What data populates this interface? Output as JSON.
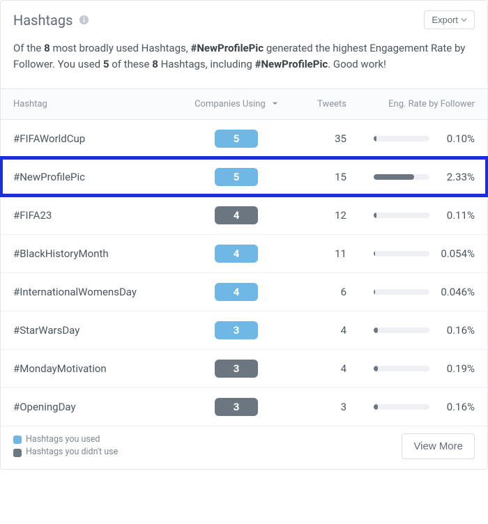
{
  "header": {
    "title": "Hashtags",
    "export_label": "Export"
  },
  "summary": {
    "pre": "Of the ",
    "total_count": "8",
    "mid1": " most broadly used Hashtags, ",
    "top_hashtag": "#NewProfilePic",
    "mid2": " generated the highest Engagement Rate by Follower. You used ",
    "used_count": "5",
    "mid3": " of these ",
    "total_count2": "8",
    "mid4": " Hashtags, including ",
    "top_hashtag2": "#NewProfilePic",
    "tail": ". Good work!"
  },
  "columns": {
    "hashtag": "Hashtag",
    "companies": "Companies Using",
    "tweets": "Tweets",
    "rate": "Eng. Rate by Follower"
  },
  "rows": [
    {
      "hashtag": "#FIFAWorldCup",
      "companies": "5",
      "used": true,
      "tweets": "35",
      "rate": "0.10%",
      "bar_pct": 5,
      "highlight": false
    },
    {
      "hashtag": "#NewProfilePic",
      "companies": "5",
      "used": true,
      "tweets": "15",
      "rate": "2.33%",
      "bar_pct": 72,
      "highlight": true
    },
    {
      "hashtag": "#FIFA23",
      "companies": "4",
      "used": false,
      "tweets": "12",
      "rate": "0.11%",
      "bar_pct": 5,
      "highlight": false
    },
    {
      "hashtag": "#BlackHistoryMonth",
      "companies": "4",
      "used": true,
      "tweets": "11",
      "rate": "0.054%",
      "bar_pct": 3,
      "highlight": false
    },
    {
      "hashtag": "#InternationalWomensDay",
      "companies": "4",
      "used": true,
      "tweets": "6",
      "rate": "0.046%",
      "bar_pct": 3,
      "highlight": false
    },
    {
      "hashtag": "#StarWarsDay",
      "companies": "3",
      "used": true,
      "tweets": "4",
      "rate": "0.16%",
      "bar_pct": 7,
      "highlight": false
    },
    {
      "hashtag": "#MondayMotivation",
      "companies": "3",
      "used": false,
      "tweets": "4",
      "rate": "0.19%",
      "bar_pct": 8,
      "highlight": false
    },
    {
      "hashtag": "#OpeningDay",
      "companies": "3",
      "used": false,
      "tweets": "3",
      "rate": "0.16%",
      "bar_pct": 7,
      "highlight": false
    }
  ],
  "legend": {
    "used": "Hashtags you used",
    "notused": "Hashtags you didn't use"
  },
  "footer": {
    "view_more": "View More"
  },
  "chart_data": {
    "type": "table",
    "title": "Hashtags",
    "columns": [
      "Hashtag",
      "Companies Using",
      "Tweets",
      "Eng. Rate by Follower"
    ],
    "series": [
      {
        "hashtag": "#FIFAWorldCup",
        "companies_using": 5,
        "you_used": true,
        "tweets": 35,
        "eng_rate_by_follower_pct": 0.1
      },
      {
        "hashtag": "#NewProfilePic",
        "companies_using": 5,
        "you_used": true,
        "tweets": 15,
        "eng_rate_by_follower_pct": 2.33
      },
      {
        "hashtag": "#FIFA23",
        "companies_using": 4,
        "you_used": false,
        "tweets": 12,
        "eng_rate_by_follower_pct": 0.11
      },
      {
        "hashtag": "#BlackHistoryMonth",
        "companies_using": 4,
        "you_used": true,
        "tweets": 11,
        "eng_rate_by_follower_pct": 0.054
      },
      {
        "hashtag": "#InternationalWomensDay",
        "companies_using": 4,
        "you_used": true,
        "tweets": 6,
        "eng_rate_by_follower_pct": 0.046
      },
      {
        "hashtag": "#StarWarsDay",
        "companies_using": 3,
        "you_used": true,
        "tweets": 4,
        "eng_rate_by_follower_pct": 0.16
      },
      {
        "hashtag": "#MondayMotivation",
        "companies_using": 3,
        "you_used": false,
        "tweets": 4,
        "eng_rate_by_follower_pct": 0.19
      },
      {
        "hashtag": "#OpeningDay",
        "companies_using": 3,
        "you_used": false,
        "tweets": 3,
        "eng_rate_by_follower_pct": 0.16
      }
    ]
  }
}
